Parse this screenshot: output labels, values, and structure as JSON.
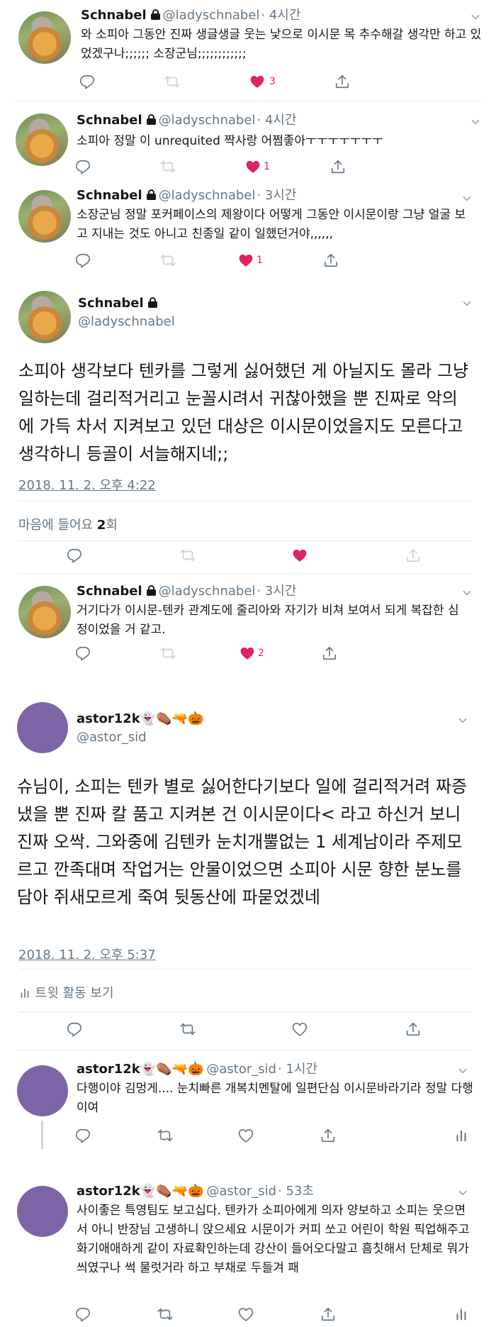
{
  "tweets": [
    {
      "name": "Schnabel",
      "handle": "@ladyschnabel",
      "time": "· 4시간",
      "text": "와 소피아 그동안 진짜 생글생글 웃는 낯으로 이시문 목 추수해갈 생각만 하고 있었겠구나;;;;;; 소장군님;;;;;;;;;;;;",
      "likes": "3"
    },
    {
      "name": "Schnabel",
      "handle": "@ladyschnabel",
      "time": "· 4시간",
      "text": "소피아 정말 이 unrequited 짝사랑 어쩜좋아ㅜㅜㅜㅜㅜㅜㅜ",
      "likes": "1"
    },
    {
      "name": "Schnabel",
      "handle": "@ladyschnabel",
      "time": "· 3시간",
      "text": "소장군님 정말 포커페이스의 제왕이다 어떻게 그동안 이시문이랑 그냥 얼굴 보고 지내는 것도 아니고 친종일 같이 일했던거야,,,,,,",
      "likes": "1"
    },
    {
      "name": "Schnabel",
      "handle": "@ladyschnabel",
      "text": "소피아 생각보다 텐카를 그렇게 싫어했던 게 아닐지도 몰라 그냥 일하는데 걸리적거리고 눈꼴시려서 귀찮아했을 뿐 진짜로 악의에 가득 차서 지켜보고 있던 대상은 이시문이었을지도 모른다고 생각하니 등골이 서늘해지네;;",
      "date": "2018. 11. 2. 오후 4:22",
      "likes_label": "마음에 들어요",
      "likes_count": "2",
      "likes_suffix": "회"
    },
    {
      "name": "Schnabel",
      "handle": "@ladyschnabel",
      "time": "· 3시간",
      "text": "거기다가 이시문-텐카 관계도에 줄리아와 자기가 비쳐 보여서 되게 복잡한 심정이었을 거 같고.",
      "likes": "2"
    },
    {
      "name": "astor12k",
      "emojis": "👻⚰️🔫🎃",
      "handle": "@astor_sid",
      "text": "슈님이, 소피는 텐카 별로 싫어한다기보다 일에 걸리적거려 짜증냈을 뿐 진짜 칼 품고 지켜본 건 이시문이다< 라고 하신거 보니 진짜 오싹. 그와중에 김텐카 눈치개뿔없는 1 세계남이라 주제모르고 깐족대며 작업거는 안물이었으면 소피아 시문 향한 분노를 담아 쥐새모르게 죽여 뒷동산에 파묻었겠네",
      "date": "2018. 11. 2. 오후 5:37",
      "activity": "트윗 활동 보기"
    },
    {
      "name": "astor12k",
      "emojis": "👻⚰️🔫🎃",
      "handle": "@astor_sid",
      "time": "· 1시간",
      "text": "다행이야 김멍게.... 눈치빠른 개복치멘탈에 일편단심 이시문바라기라 정말 다행이여"
    },
    {
      "name": "astor12k",
      "emojis": "👻⚰️🔫🎃",
      "handle": "@astor_sid",
      "time": "· 53초",
      "text": "사이좋은 특영팀도 보고십다. 텐카가 소피아에게 의자 양보하고 소피는 웃으면서 아니 반장님 고생하니 앉으세요 시문이가 커피 쏘고 어린이 학원 픽업해주고 화기애애하게 같이 자료확인하는데 강산이 들어오다말고 흠칫해서 단체로 뭐가 씌였구나 썩 물럿거라 하고 부채로 두들겨 패"
    }
  ],
  "colors": {
    "like": "#e0245e",
    "icon": "#657786",
    "avatar_purple": "#7d64a6"
  },
  "icons": [
    "reply-icon",
    "retweet-icon",
    "heart-icon",
    "share-icon",
    "analytics-icon",
    "lock-icon",
    "chevron-down-icon"
  ]
}
